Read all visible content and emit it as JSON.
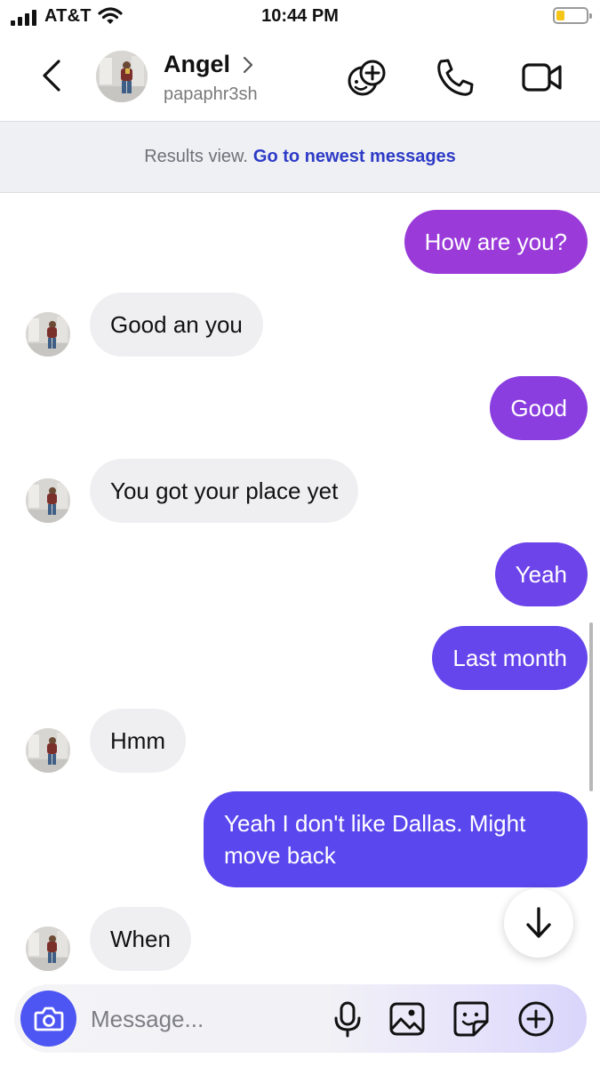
{
  "status_bar": {
    "carrier": "AT&T",
    "time": "10:44 PM",
    "battery_color": "#f5c518"
  },
  "header": {
    "name": "Angel",
    "handle": "papaphr3sh",
    "icons": [
      "back-chevron-icon",
      "game-controller-icon",
      "phone-icon",
      "video-camera-icon"
    ]
  },
  "banner": {
    "muted_text": "Results view.",
    "link_text": "Go to newest messages"
  },
  "messages": [
    {
      "dir": "out",
      "text": "How are you?",
      "color": "#9a3bd9"
    },
    {
      "dir": "in",
      "text": "Good an you"
    },
    {
      "dir": "out",
      "text": "Good",
      "color": "#8a3ee0"
    },
    {
      "dir": "in",
      "text": "You got your place yet"
    },
    {
      "dir": "out",
      "text": "Yeah",
      "color": "#6d43ea"
    },
    {
      "dir": "out",
      "text": "Last month",
      "color": "#6545ec"
    },
    {
      "dir": "in",
      "text": "Hmm"
    },
    {
      "dir": "out",
      "text": "Yeah I don't like Dallas. Might move back",
      "color": "#5a47ee"
    },
    {
      "dir": "in",
      "text": "When"
    }
  ],
  "composer": {
    "placeholder": "Message...",
    "accent": "#4d55f2",
    "icons": [
      "camera-icon",
      "microphone-icon",
      "gallery-icon",
      "sticker-icon",
      "add-icon"
    ]
  }
}
